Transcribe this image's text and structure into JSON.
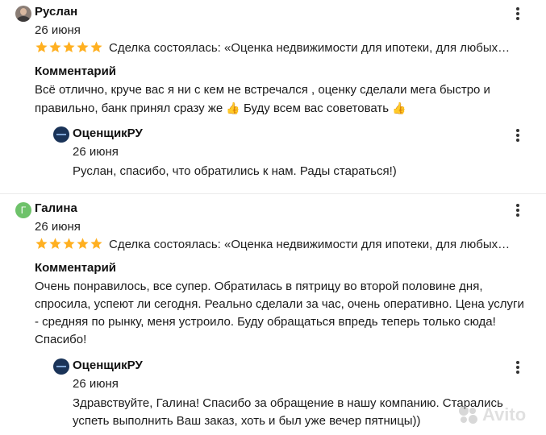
{
  "reviews": [
    {
      "author": "Руслан",
      "avatar_icon": "user-photo",
      "date": "26 июня",
      "rating": 5,
      "deal_text": "Сделка состоялась: «Оценка недвижимости для ипотеки, для любых…",
      "comment_label": "Комментарий",
      "comment_part1": "Всё отлично, круче вас я ни с кем не встречался , оценку сделали мега быстро и правильно, банк принял сразу же",
      "comment_part2": "Буду всем вас советовать",
      "reply": {
        "company": "ОценщикРУ",
        "date": "26 июня",
        "text": "Руслан, спасибо, что обратились к нам. Рады стараться!)"
      }
    },
    {
      "author": "Галина",
      "avatar_letter": "Г",
      "date": "26 июня",
      "rating": 5,
      "deal_text": "Сделка состоялась: «Оценка недвижимости для ипотеки, для любых…",
      "comment_label": "Комментарий",
      "comment": "Очень понравилось, все супер. Обратилась в пятрицу во второй половине дня, спросила, успеют ли сегодня. Реально сделали за час, очень оперативно. Цена услуги - средняя по рынку, меня устроило. Буду обращаться впредь теперь только сюда! Спасибо!",
      "reply": {
        "company": "ОценщикРУ",
        "date": "26 июня",
        "text": "Здравствуйте, Галина! Спасибо за обращение в нашу компанию. Старались успеть выполнить Ваш заказ, хоть и был уже вечер пятницы))"
      }
    }
  ],
  "icons": {
    "star_color": "#ffb021",
    "thumb": "👍"
  },
  "watermark": "Avito"
}
